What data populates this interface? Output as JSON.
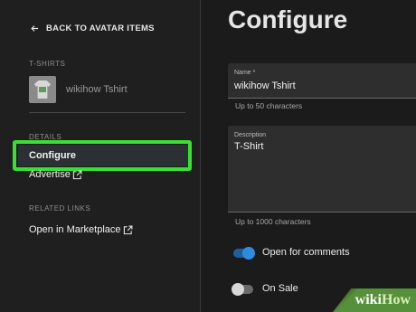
{
  "sidebar": {
    "back_label": "BACK TO AVATAR ITEMS",
    "section_tshirts": "T-SHIRTS",
    "item_name": "wikihow Tshirt",
    "section_details": "DETAILS",
    "nav_configure": "Configure",
    "nav_advertise": "Advertise",
    "section_related": "RELATED LINKS",
    "nav_marketplace": "Open in Marketplace"
  },
  "main": {
    "title": "Configure",
    "name_label": "Name *",
    "name_value": "wikihow Tshirt",
    "name_helper": "Up to 50 characters",
    "desc_label": "Description",
    "desc_value": "T-Shirt",
    "desc_helper": "Up to 1000 characters",
    "comments_label": "Open for comments",
    "comments_on": true,
    "sale_label": "On Sale",
    "sale_on": false
  },
  "watermark": {
    "wiki": "wiki",
    "how": "How"
  },
  "colors": {
    "accent_toggle": "#2f8be0",
    "highlight": "#38e030"
  }
}
